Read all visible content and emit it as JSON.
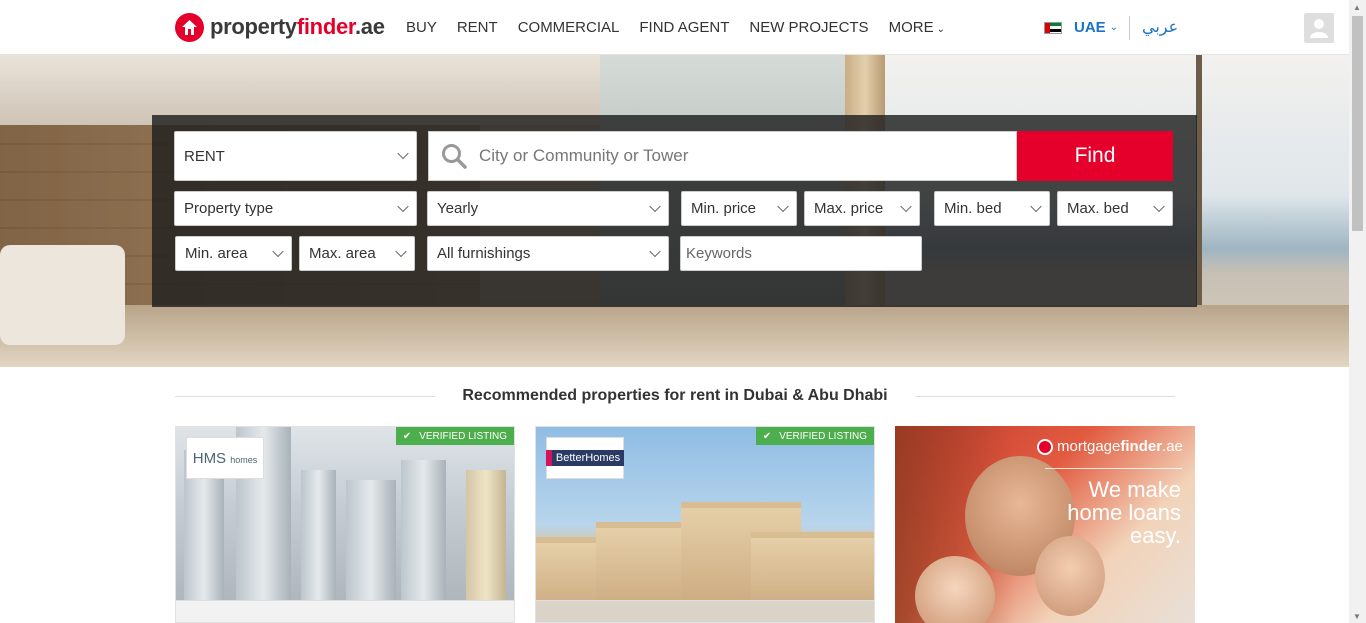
{
  "header": {
    "logo": {
      "brand": "property",
      "brand_bold": "finder",
      "tld": ".ae"
    },
    "nav": [
      "BUY",
      "RENT",
      "COMMERCIAL",
      "FIND AGENT",
      "NEW PROJECTS",
      "MORE"
    ],
    "country": "UAE",
    "language": "عربي"
  },
  "search": {
    "category": "RENT",
    "location_placeholder": "City or Community or Tower",
    "find_label": "Find",
    "property_type": "Property type",
    "frequency": "Yearly",
    "min_price": "Min. price",
    "max_price": "Max. price",
    "min_bed": "Min. bed",
    "max_bed": "Max. bed",
    "min_area": "Min. area",
    "max_area": "Max. area",
    "furnishings": "All furnishings",
    "keywords_placeholder": "Keywords"
  },
  "recommended": {
    "title": "Recommended properties for rent in Dubai & Abu Dhabi",
    "cards": [
      {
        "agent": "HMS",
        "agent_suffix": "homes",
        "badge": "VERIFIED LISTING"
      },
      {
        "agent": "BetterHomes",
        "badge": "VERIFIED LISTING"
      }
    ],
    "ad": {
      "brand": "mortgage",
      "brand_bold": "finder",
      "tld": ".ae",
      "slogan_1": "We make",
      "slogan_2": "home loans",
      "slogan_3": "easy."
    }
  },
  "colors": {
    "brand_red": "#e4002b",
    "link_blue": "#1a73c6",
    "verified_green": "#4cae4c"
  }
}
